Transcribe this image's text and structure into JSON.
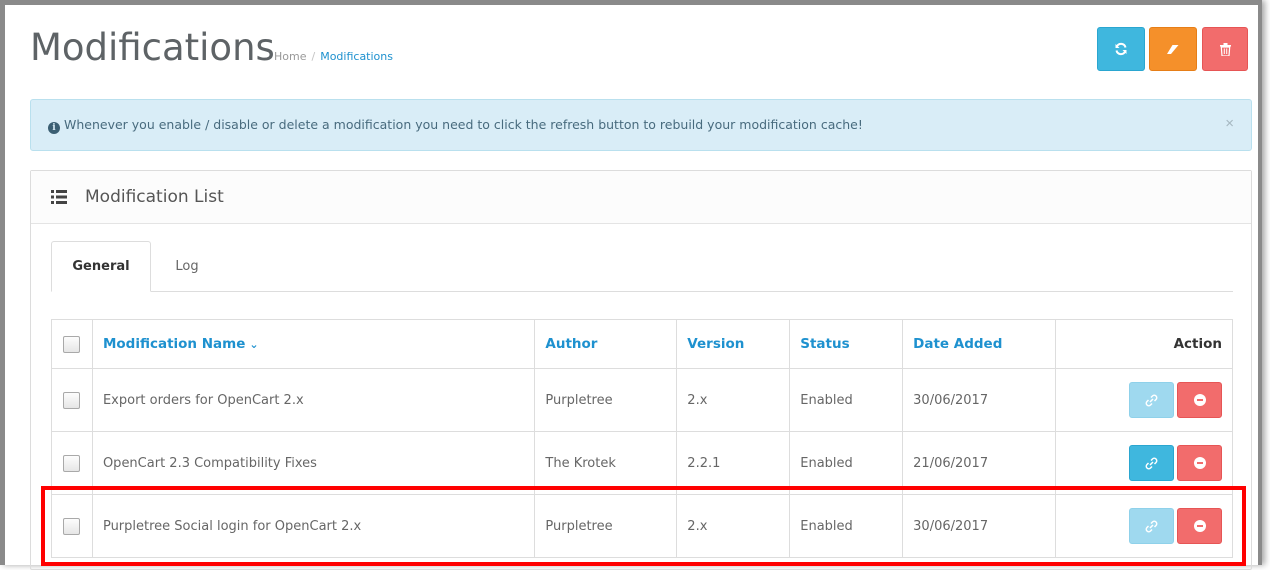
{
  "header": {
    "title": "Modifications",
    "breadcrumb": [
      {
        "label": "Home"
      },
      {
        "label": "Modifications"
      }
    ],
    "separator": "/",
    "toolbar": {
      "refresh_icon": "refresh-icon",
      "clear_icon": "eraser-icon",
      "delete_icon": "trash-icon"
    }
  },
  "alert": {
    "icon": "info-circle-icon",
    "text": "Whenever you enable / disable or delete a modification you need to click the refresh button to rebuild your modification cache!",
    "close": "×"
  },
  "panel": {
    "title": "Modification List",
    "icon": "list-icon",
    "tabs": [
      {
        "label": "General",
        "active": true
      },
      {
        "label": "Log",
        "active": false
      }
    ]
  },
  "table": {
    "columns": {
      "name": "Modification Name",
      "author": "Author",
      "version": "Version",
      "status": "Status",
      "date": "Date Added",
      "action": "Action"
    },
    "sort_indicator": "⌄",
    "rows": [
      {
        "name": "Export orders for OpenCart 2.x",
        "author": "Purpletree",
        "version": "2.x",
        "status": "Enabled",
        "date": "30/06/2017"
      },
      {
        "name": "OpenCart 2.3 Compatibility Fixes",
        "author": "The Krotek",
        "version": "2.2.1",
        "status": "Enabled",
        "date": "21/06/2017"
      },
      {
        "name": "Purpletree Social login for OpenCart 2.x",
        "author": "Purpletree",
        "version": "2.x",
        "status": "Enabled",
        "date": "30/06/2017"
      }
    ]
  },
  "colors": {
    "info": "#3fb7de",
    "warning": "#f5902a",
    "danger": "#f26c6c",
    "link": "#1e91cf",
    "highlight": "#ff0000"
  }
}
